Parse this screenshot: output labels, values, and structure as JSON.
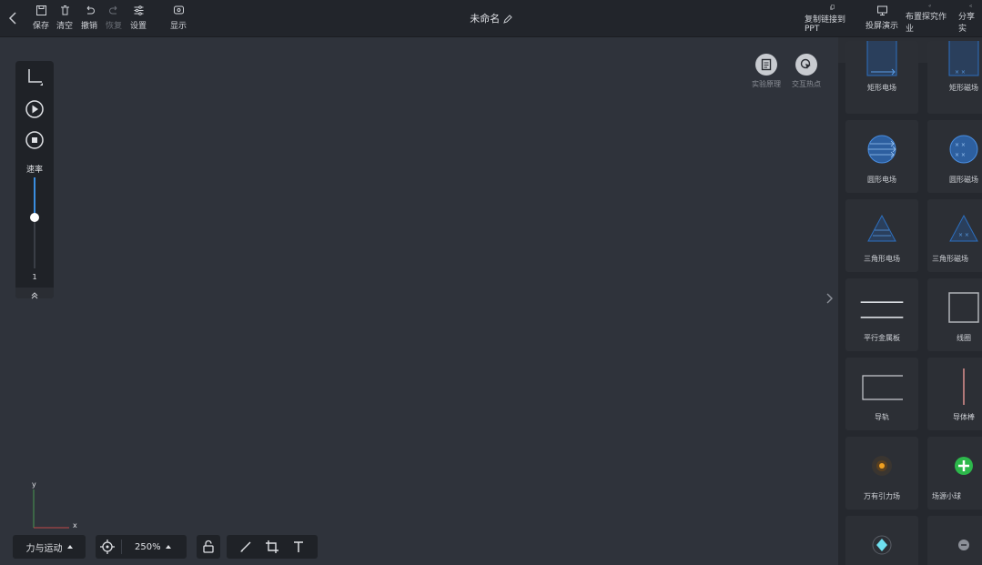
{
  "topbar": {
    "title": "未命名",
    "left_buttons": [
      {
        "label": "保存",
        "icon": "save-icon"
      },
      {
        "label": "清空",
        "icon": "trash-icon"
      },
      {
        "label": "撤销",
        "icon": "undo-icon"
      },
      {
        "label": "恢复",
        "icon": "redo-icon",
        "disabled": true
      },
      {
        "label": "设置",
        "icon": "sliders-icon"
      },
      {
        "label": "显示",
        "icon": "display-icon"
      }
    ],
    "right_buttons": [
      {
        "label": "复制链接到PPT",
        "icon": "copy-link-icon"
      },
      {
        "label": "投屏演示",
        "icon": "cast-icon"
      },
      {
        "label": "布置探究作业",
        "icon": "send-icon"
      },
      {
        "label": "分享实",
        "icon": "share-icon"
      }
    ]
  },
  "control_panel": {
    "speed_label": "速率",
    "speed_value": "1",
    "speed_level": 0.44
  },
  "canvas_tools": [
    {
      "label": "实验原理",
      "icon": "document-icon"
    },
    {
      "label": "交互热点",
      "icon": "pointer-icon"
    }
  ],
  "components": [
    {
      "label": "矩形电场",
      "icon": "rect-electric-field-icon"
    },
    {
      "label": "矩形磁场",
      "icon": "rect-magnetic-field-icon"
    },
    {
      "label": "圆形电场",
      "icon": "circle-electric-field-icon"
    },
    {
      "label": "圆形磁场",
      "icon": "circle-magnetic-field-icon"
    },
    {
      "label": "三角形电场",
      "icon": "triangle-electric-field-icon"
    },
    {
      "label": "三角形磁场",
      "icon": "triangle-magnetic-field-icon"
    },
    {
      "label": "平行金属板",
      "icon": "parallel-plates-icon"
    },
    {
      "label": "线圈",
      "icon": "coil-icon"
    },
    {
      "label": "导轨",
      "icon": "rail-icon"
    },
    {
      "label": "导体棒",
      "icon": "conductor-rod-icon"
    },
    {
      "label": "万有引力场",
      "icon": "gravity-field-icon"
    },
    {
      "label": "场源小球",
      "icon": "source-ball-icon"
    },
    {
      "label": "",
      "icon": "particle-icon"
    },
    {
      "label": "",
      "icon": "neutral-particle-icon"
    }
  ],
  "axis": {
    "x": "x",
    "y": "y"
  },
  "bottom": {
    "mode": "力与运动",
    "zoom": "250%"
  },
  "colors": {
    "canvas": "#2f333b",
    "topbar": "#22252b",
    "accent": "#3a8ee0",
    "field_blue": "#2d6fbf",
    "green": "#2db84b"
  }
}
